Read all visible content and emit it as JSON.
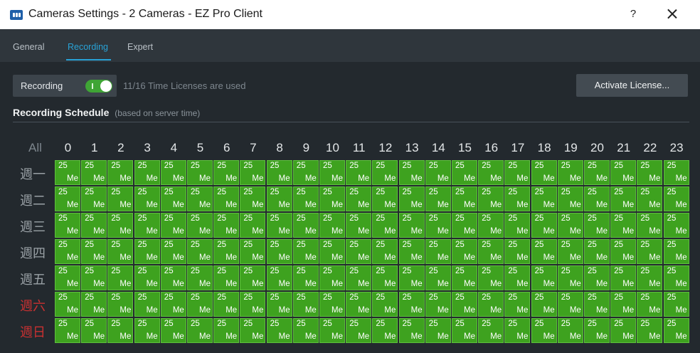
{
  "window": {
    "title": "Cameras Settings - 2 Cameras - EZ Pro Client",
    "help_label": "?",
    "icon": "app-icon"
  },
  "tabs": [
    {
      "label": "General",
      "active": false
    },
    {
      "label": "Recording",
      "active": true
    },
    {
      "label": "Expert",
      "active": false
    }
  ],
  "recording": {
    "label": "Recording",
    "enabled": true,
    "license_text": "11/16 Time Licenses are used",
    "activate_button": "Activate License..."
  },
  "schedule": {
    "title": "Recording Schedule",
    "subtitle": "(based on server time)",
    "all_label": "All",
    "hours": [
      "0",
      "1",
      "2",
      "3",
      "4",
      "5",
      "6",
      "7",
      "8",
      "9",
      "10",
      "11",
      "12",
      "13",
      "14",
      "15",
      "16",
      "17",
      "18",
      "19",
      "20",
      "21",
      "22",
      "23"
    ],
    "days": [
      {
        "label": "週一",
        "weekend": false
      },
      {
        "label": "週二",
        "weekend": false
      },
      {
        "label": "週三",
        "weekend": false
      },
      {
        "label": "週四",
        "weekend": false
      },
      {
        "label": "週五",
        "weekend": false
      },
      {
        "label": "週六",
        "weekend": true
      },
      {
        "label": "週日",
        "weekend": true
      }
    ],
    "cell_fps": "25",
    "cell_quality": "Me"
  },
  "colors": {
    "accent": "#28a2d6",
    "cell_green": "#3ea21f",
    "toggle_on": "#3fa535",
    "weekend_red": "#c93131"
  }
}
